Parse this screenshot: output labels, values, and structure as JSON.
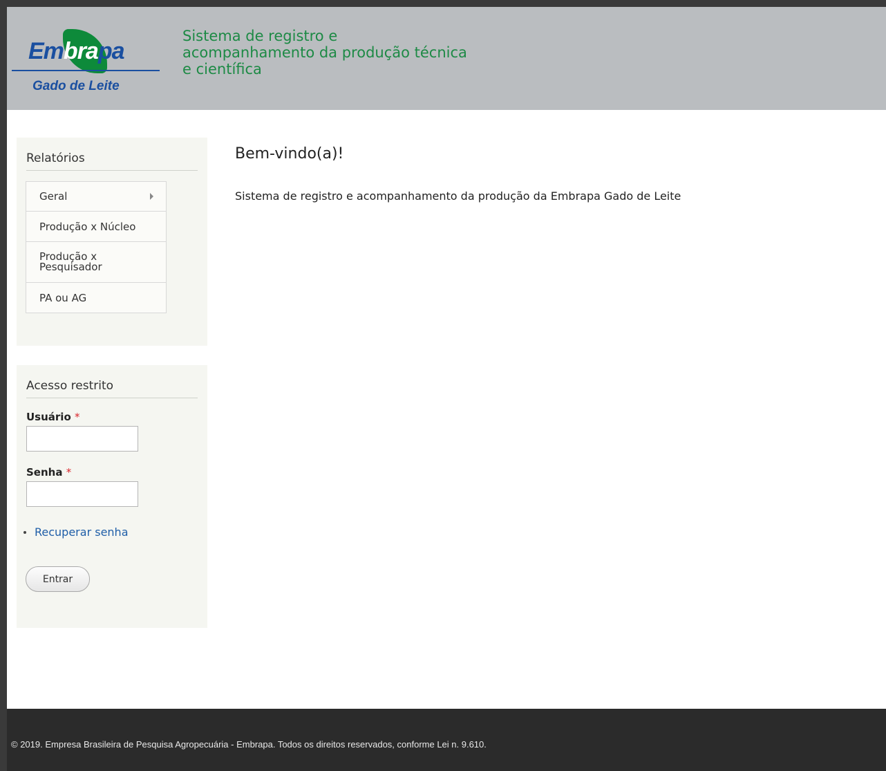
{
  "header": {
    "logo": {
      "word_start": "Em",
      "word_mid": "bra",
      "word_end": "pa",
      "subtitle": "Gado de Leite"
    },
    "site_title": "Sistema de registro e acompanhamento da produção técnica e científica"
  },
  "sidebar": {
    "relatorios": {
      "title": "Relatórios",
      "items": [
        {
          "label": "Geral",
          "has_submenu": true
        },
        {
          "label": "Produção x Núcleo"
        },
        {
          "label": "Produção x Pesquisador"
        },
        {
          "label": "PA ou AG"
        }
      ]
    },
    "acesso": {
      "title": "Acesso restrito",
      "username_label": "Usuário",
      "password_label": "Senha",
      "required_marker": "*",
      "username_value": "",
      "password_value": "",
      "recover_link": "Recuperar senha",
      "submit_label": "Entrar"
    }
  },
  "main": {
    "title": "Bem-vindo(a)!",
    "text": "Sistema de registro e acompanhamento da produção da Embrapa Gado de Leite"
  },
  "footer": {
    "text": "© 2019. Empresa Brasileira de Pesquisa Agropecuária - Embrapa. Todos os direitos reservados, conforme Lei n. 9.610."
  },
  "colors": {
    "header_bg": "#babdc0",
    "brand_blue": "#1a4fa0",
    "brand_green": "#0d8a3a",
    "title_green": "#1d8a45",
    "link_blue": "#1f5ea8",
    "footer_bg": "#2b2b2b",
    "required_red": "#d9262c"
  },
  "icons": {
    "submenu": "chevron-right-icon",
    "bullet": "bullet-icon"
  }
}
